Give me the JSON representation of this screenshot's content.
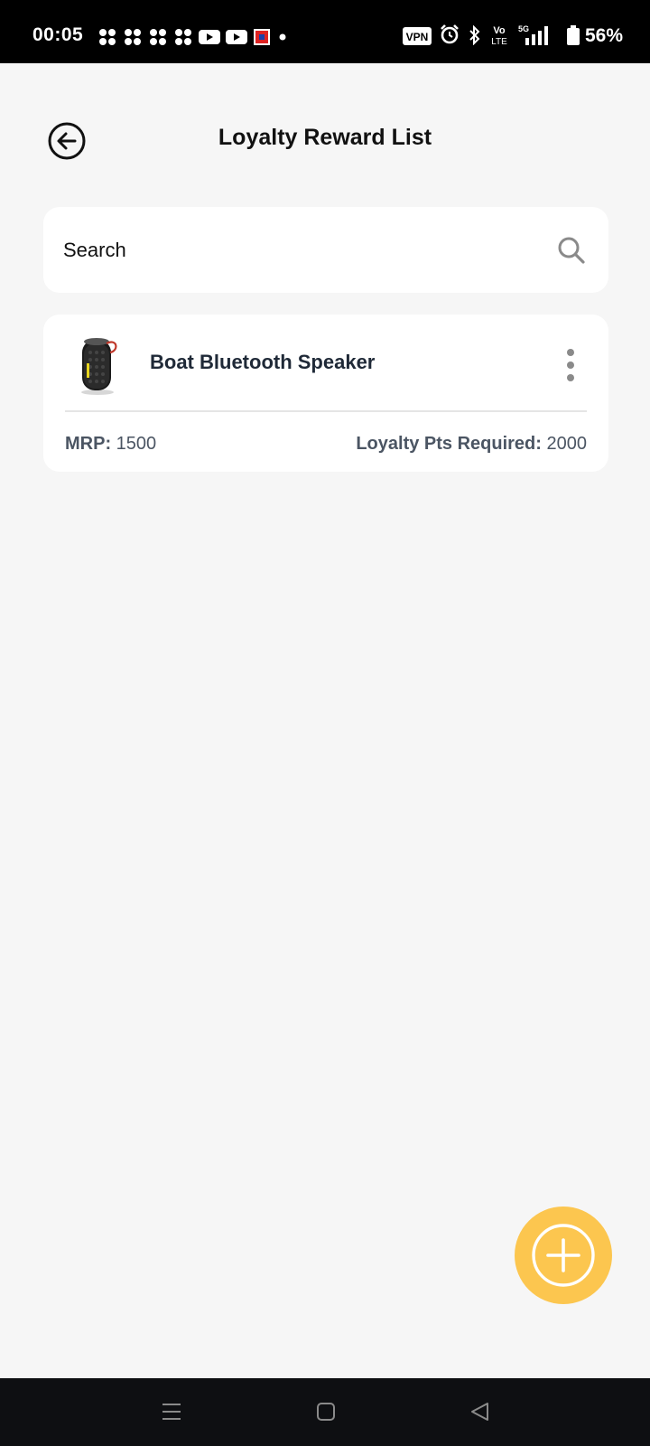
{
  "status_bar": {
    "time": "00:05",
    "battery_percent": "56%",
    "network": "5G",
    "vpn_label": "VPN",
    "volte_top": "Vo",
    "volte_bottom": "LTE"
  },
  "header": {
    "title": "Loyalty Reward List"
  },
  "search": {
    "placeholder": "Search",
    "value": ""
  },
  "rewards": [
    {
      "name": "Boat Bluetooth Speaker",
      "mrp_label": "MRP:",
      "mrp_value": "1500",
      "points_label": "Loyalty Pts Required:",
      "points_value": "2000",
      "image_icon": "speaker-image"
    }
  ],
  "colors": {
    "background": "#f6f6f6",
    "card": "#ffffff",
    "fab": "#fcc64f",
    "status_bar": "#000000",
    "nav_bar": "#0e0f12"
  }
}
